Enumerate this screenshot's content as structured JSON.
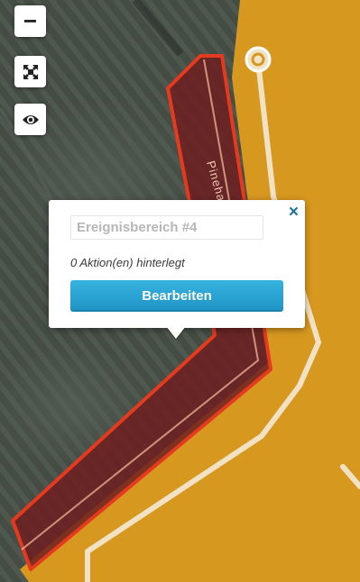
{
  "map": {
    "colors": {
      "field": "#d7981f",
      "area_fill": "#6e1e20",
      "area_border": "#e63a1e",
      "path": "#f2e2c5",
      "aerial": "#4a524a"
    },
    "street_label": "Pineha"
  },
  "controls": {
    "zoom_out_label": "−",
    "fit_icon": "fit-bounds-icon",
    "eye_icon": "eye-icon"
  },
  "popup": {
    "close_label": "×",
    "name_field_placeholder": "Ereignisbereich #4",
    "actions_note": "0 Aktion(en) hinterlegt",
    "edit_button_label": "Bearbeiten"
  }
}
